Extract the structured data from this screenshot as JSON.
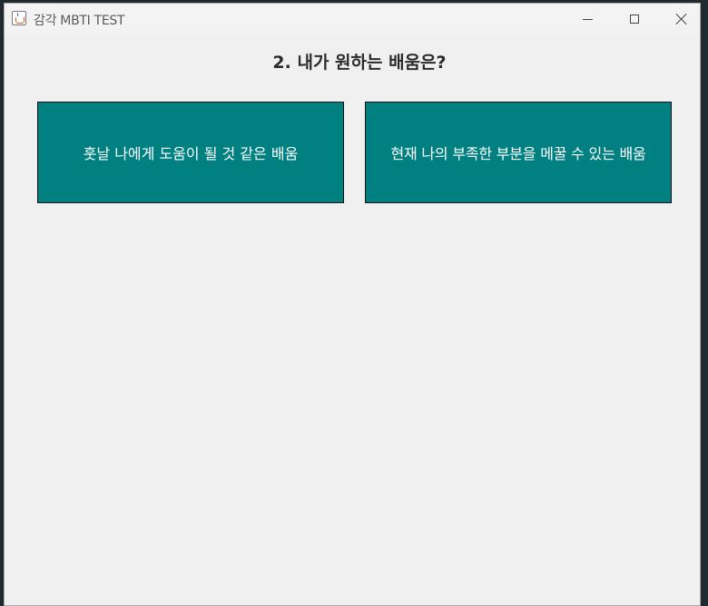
{
  "window": {
    "title": "감각 MBTI TEST"
  },
  "question": {
    "text": "2. 내가 원하는 배움은?"
  },
  "answers": [
    {
      "label": "훗날 나에게 도움이 될 것 같은 배움"
    },
    {
      "label": "현재 나의 부족한 부분을 메꿀 수 있는 배움"
    }
  ],
  "colors": {
    "answer_bg": "#008080",
    "window_bg": "#f0f0f0",
    "answer_text": "#ffffff"
  },
  "icons": {
    "app": "java-cup-icon",
    "minimize": "minimize-icon",
    "maximize": "maximize-icon",
    "close": "close-icon"
  }
}
